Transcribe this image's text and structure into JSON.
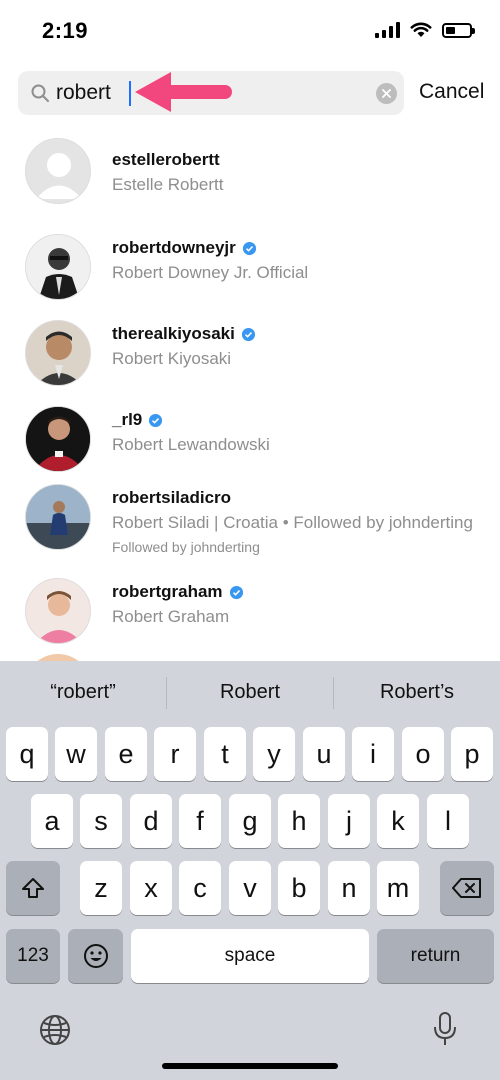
{
  "status_bar": {
    "time": "2:19"
  },
  "search": {
    "query": "robert",
    "cancel_label": "Cancel"
  },
  "results": [
    {
      "username": "estellerobertt",
      "fullname": "Estelle Robertt",
      "verified": false,
      "subline": ""
    },
    {
      "username": "robertdowneyjr",
      "fullname": "Robert Downey Jr. Official",
      "verified": true,
      "subline": ""
    },
    {
      "username": "therealkiyosaki",
      "fullname": "Robert Kiyosaki",
      "verified": true,
      "subline": ""
    },
    {
      "username": "_rl9",
      "fullname": "Robert Lewandowski",
      "verified": true,
      "subline": ""
    },
    {
      "username": "robertsiladicro",
      "fullname": "Robert Siladi | Croatia • Followed by johnderting",
      "verified": false,
      "subline": "Followed by johnderting"
    },
    {
      "username": "robertgraham",
      "fullname": "Robert Graham",
      "verified": true,
      "subline": ""
    }
  ],
  "keyboard": {
    "suggestions": [
      "“robert”",
      "Robert",
      "Robert’s"
    ],
    "row1": [
      "q",
      "w",
      "e",
      "r",
      "t",
      "y",
      "u",
      "i",
      "o",
      "p"
    ],
    "row2": [
      "a",
      "s",
      "d",
      "f",
      "g",
      "h",
      "j",
      "k",
      "l"
    ],
    "row3": [
      "z",
      "x",
      "c",
      "v",
      "b",
      "n",
      "m"
    ],
    "numbers_label": "123",
    "space_label": "space",
    "return_label": "return"
  },
  "colors": {
    "verified_blue": "#3897f0",
    "arrow_pink": "#f2477e",
    "keyboard_bg": "#d1d4da"
  }
}
